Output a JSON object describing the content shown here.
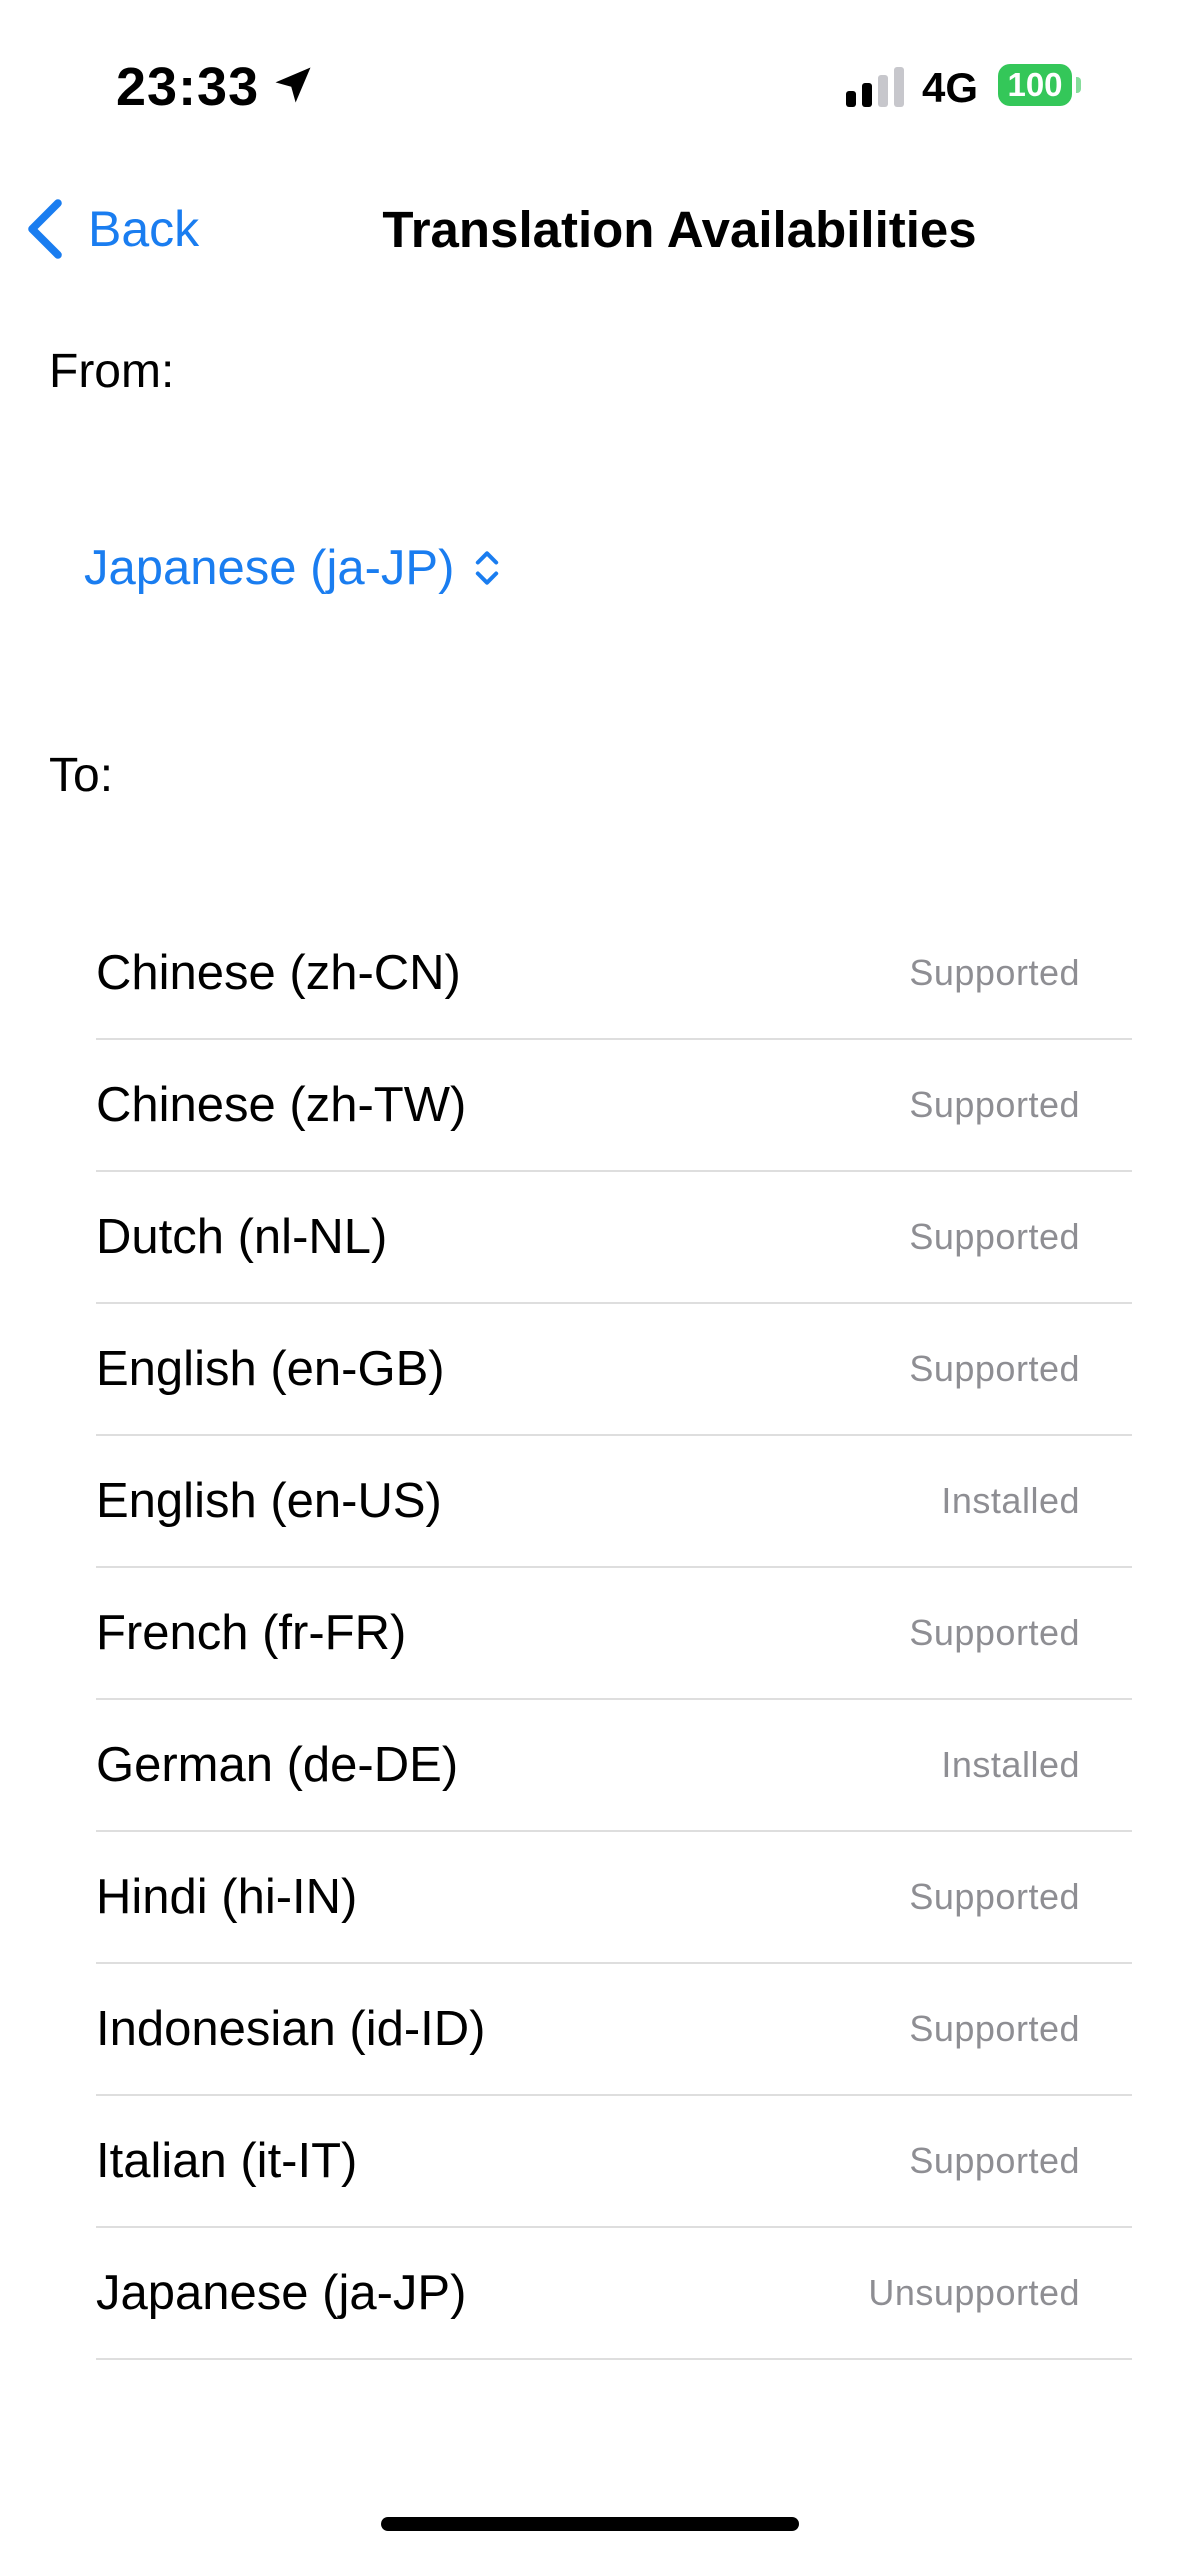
{
  "status_bar": {
    "time": "23:33",
    "network": "4G",
    "battery": "100",
    "battery_color": "#34c759",
    "icons": [
      "location-arrow-icon",
      "signal-icon"
    ]
  },
  "nav": {
    "back_label": "Back",
    "title": "Translation Availabilities",
    "accent_color": "#1a7df0"
  },
  "from": {
    "label": "From:",
    "selected": "Japanese (ja-JP)"
  },
  "to": {
    "label": "To:"
  },
  "languages": [
    {
      "name": "Chinese (zh-CN)",
      "status": "Supported"
    },
    {
      "name": "Chinese (zh-TW)",
      "status": "Supported"
    },
    {
      "name": "Dutch (nl-NL)",
      "status": "Supported"
    },
    {
      "name": "English (en-GB)",
      "status": "Supported"
    },
    {
      "name": "English (en-US)",
      "status": "Installed"
    },
    {
      "name": "French (fr-FR)",
      "status": "Supported"
    },
    {
      "name": "German (de-DE)",
      "status": "Installed"
    },
    {
      "name": "Hindi (hi-IN)",
      "status": "Supported"
    },
    {
      "name": "Indonesian (id-ID)",
      "status": "Supported"
    },
    {
      "name": "Italian (it-IT)",
      "status": "Supported"
    },
    {
      "name": "Japanese (ja-JP)",
      "status": "Unsupported"
    }
  ]
}
